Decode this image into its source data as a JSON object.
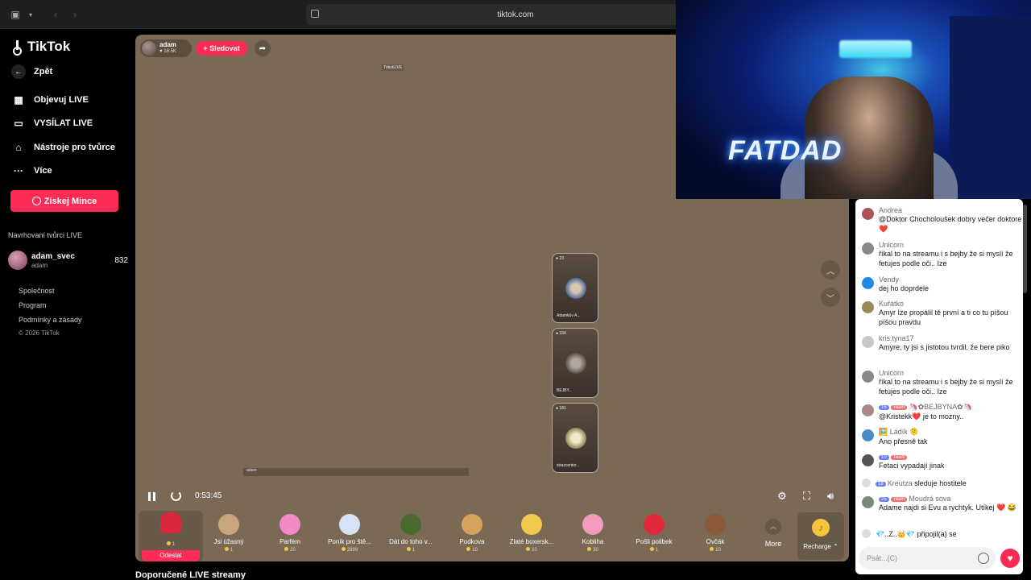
{
  "browser": {
    "url": "tiktok.com"
  },
  "sidebar": {
    "logo": "TikTok",
    "back": "Zpět",
    "nav": [
      "Objevuj LIVE",
      "VYSÍLAT LIVE",
      "Nástroje pro tvůrce",
      "Více"
    ],
    "coins_button": "Získej Mince",
    "suggested_title": "Navrhovaní tvůrci LIVE",
    "creator": {
      "name": "adam_svec",
      "handle": "adam",
      "count": "832"
    },
    "footer": [
      "Společnost",
      "Program",
      "Podmínky a zásady"
    ],
    "copyright": "© 2026 TikTok"
  },
  "stream": {
    "host_name": "adam",
    "host_likes": "18.5K",
    "follow": "+ Sledovat",
    "live_label": "TrikotLIVE",
    "guests": [
      {
        "count": "23",
        "name": "Adamkův A..."
      },
      {
        "count": "164",
        "name": "BEJBY.."
      },
      {
        "count": "181",
        "name": "strazcentor..."
      }
    ],
    "time": "0:53:45",
    "scrub_label": "adam"
  },
  "gifts": [
    {
      "name": "",
      "price": "1",
      "color": "#d9273c",
      "selected": true
    },
    {
      "name": "Jsi úžasný",
      "price": "1",
      "color": "#c9a57d"
    },
    {
      "name": "Parfém",
      "price": "20",
      "color": "#f08bc8"
    },
    {
      "name": "Poník pro ště...",
      "price": "2999",
      "color": "#d9e2f5"
    },
    {
      "name": "Dát do toho v...",
      "price": "1",
      "color": "#4a6a2e"
    },
    {
      "name": "Podkova",
      "price": "10",
      "color": "#d6a35f"
    },
    {
      "name": "Zlaté boxersk...",
      "price": "10",
      "color": "#f0c94d"
    },
    {
      "name": "Kobliha",
      "price": "30",
      "color": "#f29bbd"
    },
    {
      "name": "Pošli polibek",
      "price": "1",
      "color": "#e0283a"
    },
    {
      "name": "Ovčák",
      "price": "10",
      "color": "#8a5a3a"
    }
  ],
  "send_label": "Odeslat",
  "more_label": "More",
  "recharge_label": "Recharge",
  "recommend_title": "Doporučené LIVE streamy",
  "cam": {
    "neon": "FATDAD"
  },
  "chat": {
    "messages": [
      {
        "user": "Andrea",
        "text": "@Doktor Chocholoušek dobry večer doktore ❤️",
        "avatar": "#a55"
      },
      {
        "user": "Unicorn",
        "text": "říkal to na streamu i s bejby že si myslí že fetujes podle oči.. Ize",
        "avatar": "#888"
      },
      {
        "user": "Vendy",
        "text": "dej ho doprdele",
        "avatar": "#1e88e5"
      },
      {
        "user": "Kuřátko",
        "text": "Amyr Ize propálil tě první a ti co tu píšou píšou pravdu",
        "avatar": "#9a8a5a"
      },
      {
        "user": "kris.tyna17",
        "text": "Amyre, ty jsi s jistotou tvrdil, že bere piko",
        "avatar": "#c8c8c8"
      },
      {
        "user": "Unicorn",
        "text": "říkal to na streamu i s bejby že si myslí že fetujes podle oči.. Ize",
        "avatar": "#888"
      },
      {
        "user": "🦄✿BEJBYNA✿🦄",
        "text": "@Kristekk❤️ je to mozny..",
        "avatar": "#a88",
        "level": "16",
        "team": "Team"
      },
      {
        "user": "🖼️ Ládík 🫠",
        "text": "Ano přesně tak",
        "avatar": "#4a8ac8"
      },
      {
        "user": "",
        "text": "Fetaci vypadají jinak",
        "avatar": "#555",
        "level": "10",
        "team": "Team"
      }
    ],
    "follow_event": {
      "level": "18",
      "user": "Kreutza",
      "text": "sleduje hostitele"
    },
    "last": {
      "level": "25",
      "team": "Team",
      "user": "Moudrá sova",
      "text": "Adame najdi si Evu a rychtyk. Utíkej ❤️ 😂"
    },
    "join_event": {
      "user": "💎..Z..👑💎",
      "text": "připojil(a) se"
    },
    "input_placeholder": "Psát...(C)"
  }
}
